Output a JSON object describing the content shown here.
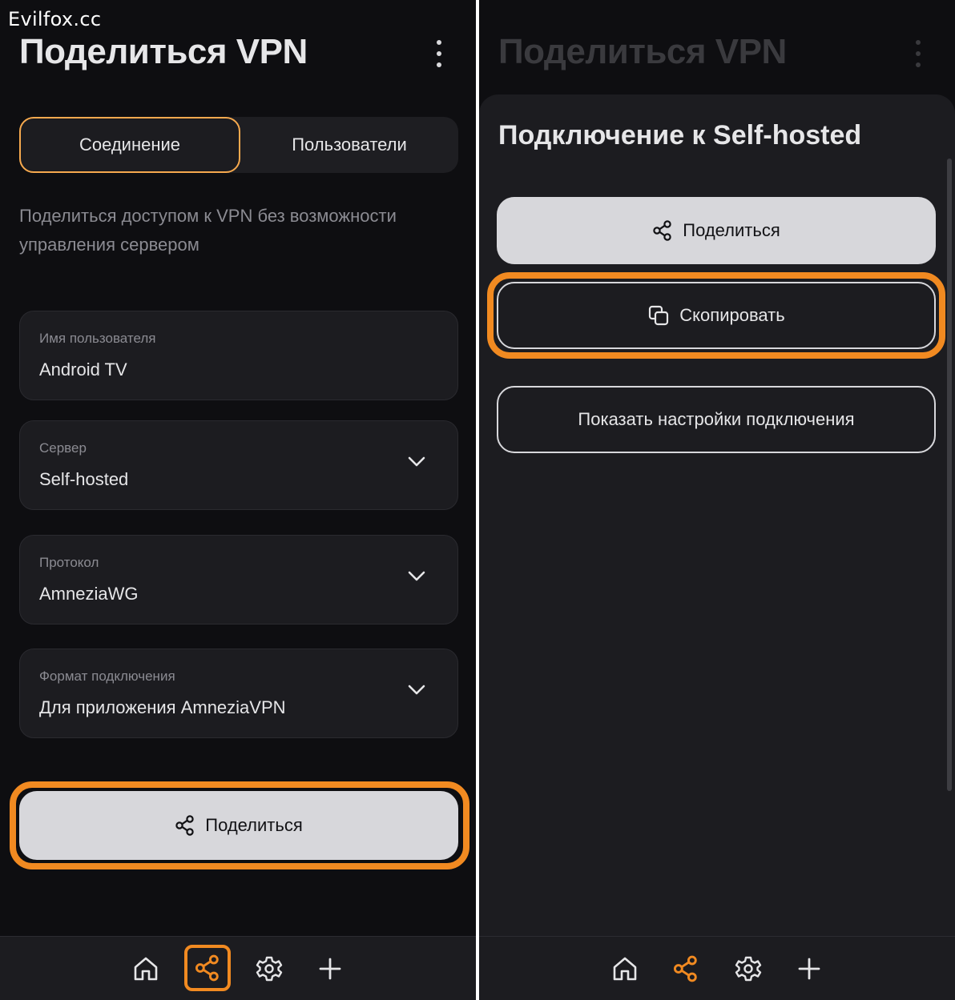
{
  "watermark": "Evilfox.cc",
  "left": {
    "title": "Поделиться VPN",
    "tabs": [
      {
        "label": "Соединение"
      },
      {
        "label": "Пользователи"
      }
    ],
    "description": "Поделиться доступом к VPN без возможности управления сервером",
    "fields": [
      {
        "label": "Имя пользователя",
        "value": "Android TV"
      },
      {
        "label": "Сервер",
        "value": "Self-hosted"
      },
      {
        "label": "Протокол",
        "value": "AmneziaWG"
      },
      {
        "label": "Формат подключения",
        "value": "Для приложения AmneziaVPN"
      }
    ],
    "share_button": "Поделиться"
  },
  "right": {
    "title": "Поделиться VPN",
    "sheet_title": "Подключение к Self-hosted",
    "share_button": "Поделиться",
    "copy_button": "Скопировать",
    "settings_button": "Показать настройки подключения"
  },
  "nav": {
    "items": [
      "home-icon",
      "share-icon",
      "gear-icon",
      "plus-icon"
    ],
    "active": "share-icon"
  },
  "colors": {
    "background": "#0e0e11",
    "surface": "#1c1c20",
    "accent": "#f18a21",
    "tab_border": "#f6a94e",
    "button_light": "#d7d7db"
  }
}
